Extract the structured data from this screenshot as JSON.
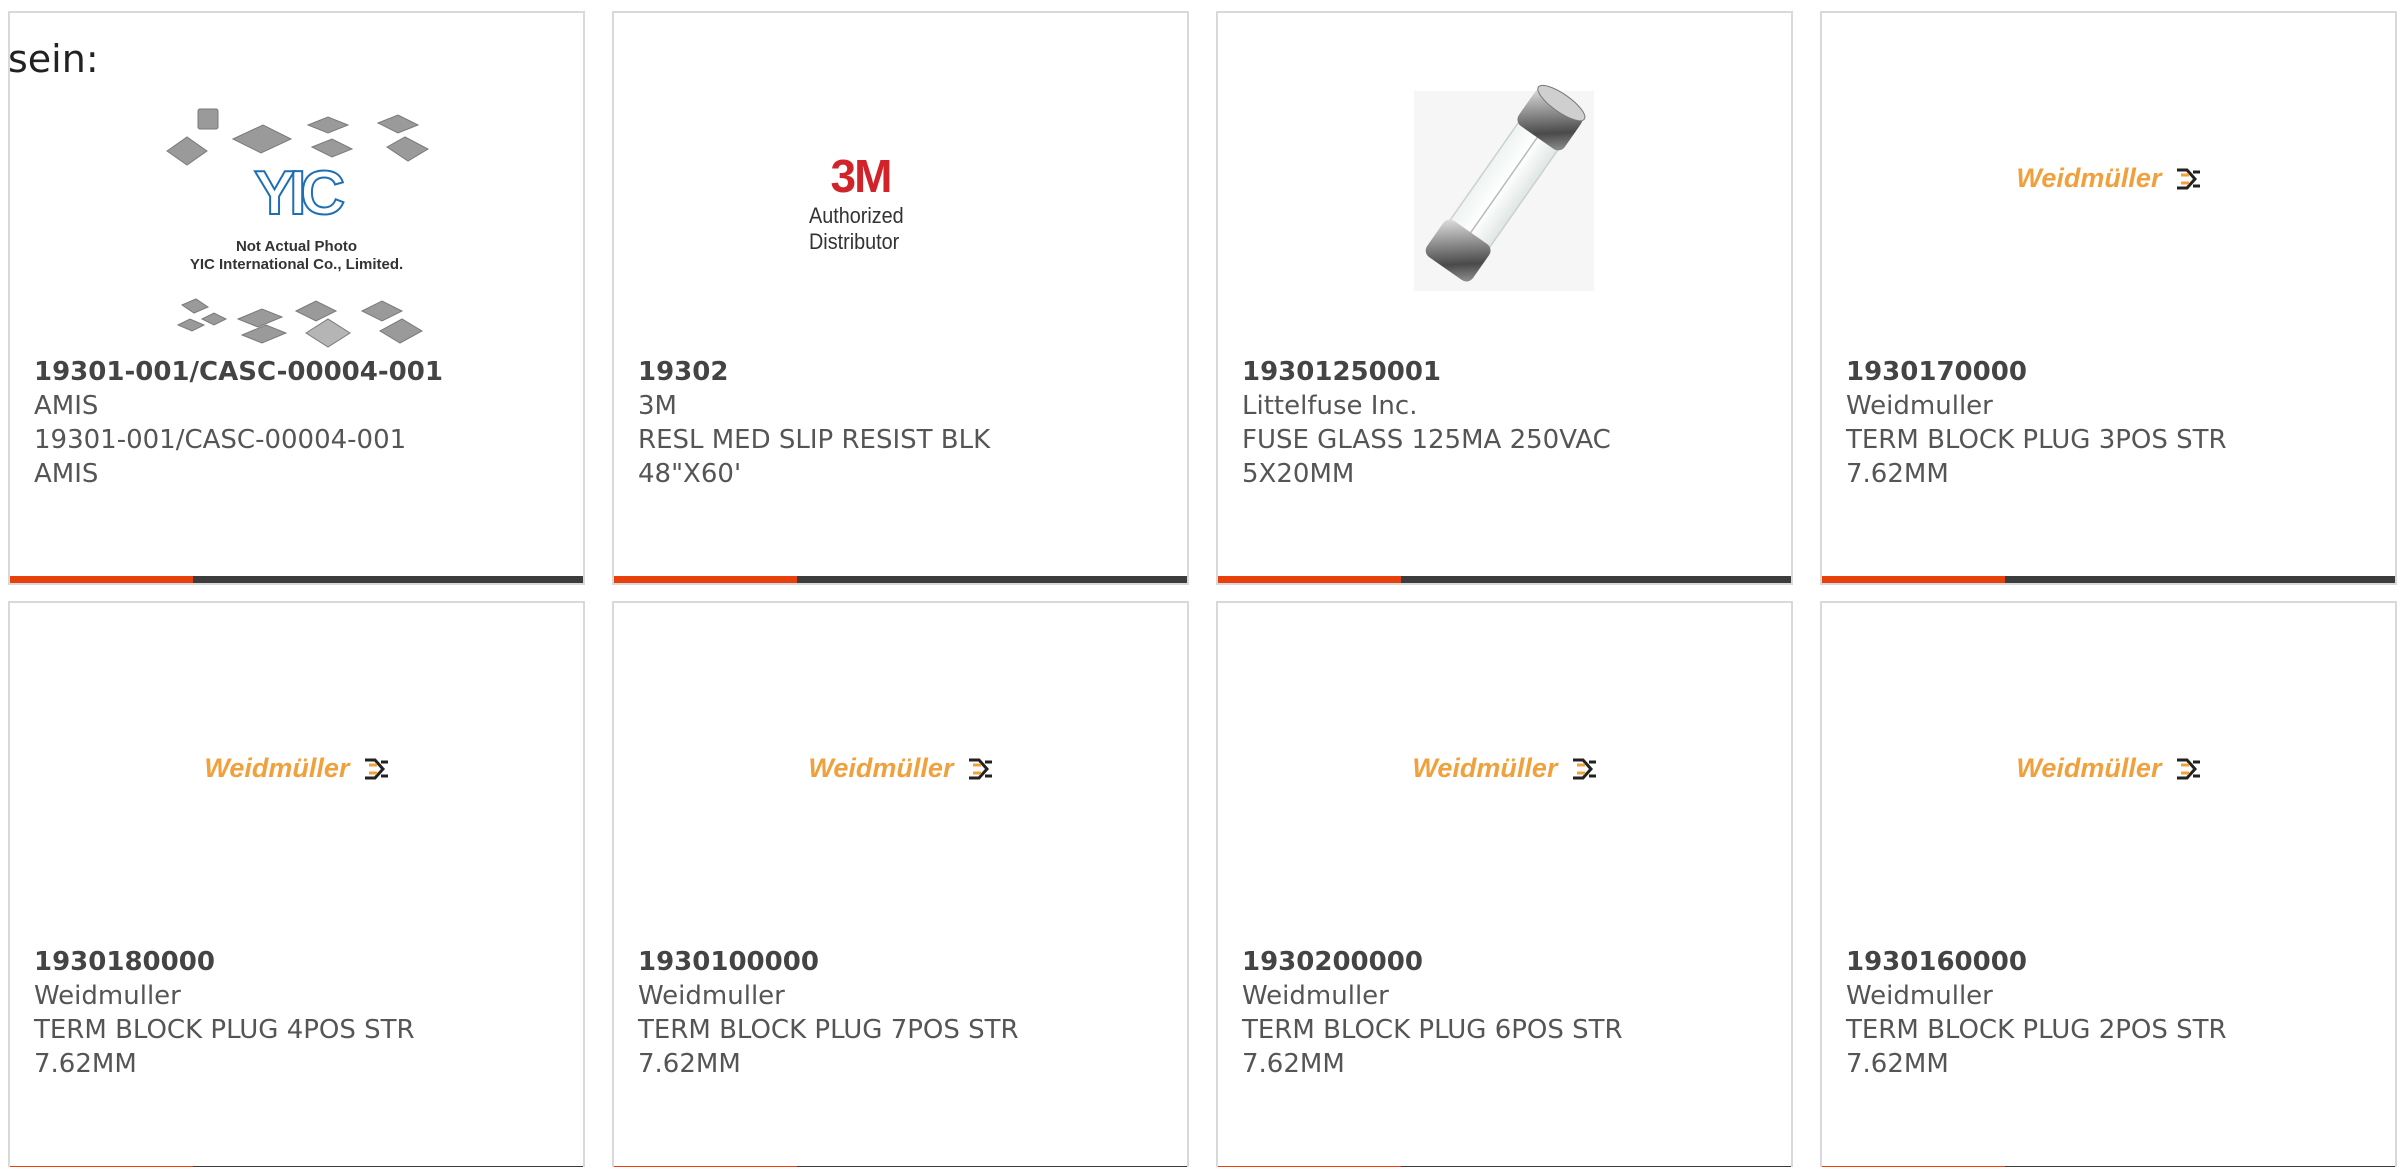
{
  "intro_text": "sein:",
  "colors": {
    "accent": "#e8400c",
    "bar": "#3c3c3c",
    "border": "#d9d9d9",
    "weidmuller": "#f0a03c",
    "logo_3m": "#d2232a",
    "yic_blue": "#1f6fb5"
  },
  "products": [
    {
      "part_number": "19301-001/CASC-00004-001",
      "manufacturer": "AMIS",
      "desc_line1": "19301-001/CASC-00004-001",
      "desc_line2": "AMIS",
      "image": "yic-placeholder",
      "image_caption_1": "Not Actual Photo",
      "image_caption_2": "YIC International Co., Limited.",
      "image_logo": "YIC"
    },
    {
      "part_number": "19302",
      "manufacturer": "3M",
      "desc_line1": "RESL MED SLIP RESIST BLK",
      "desc_line2": "48\"X60'",
      "image": "3m-logo",
      "logo_mark": "3M",
      "logo_sub": "Authorized Distributor"
    },
    {
      "part_number": "19301250001",
      "manufacturer": "Littelfuse Inc.",
      "desc_line1": "FUSE GLASS 125MA 250VAC",
      "desc_line2": "5X20MM",
      "image": "glass-fuse-photo"
    },
    {
      "part_number": "1930170000",
      "manufacturer": "Weidmuller",
      "desc_line1": "TERM BLOCK PLUG 3POS STR",
      "desc_line2": "7.62MM",
      "image": "weidmuller-logo",
      "logo_word": "Weidmüller"
    },
    {
      "part_number": "1930180000",
      "manufacturer": "Weidmuller",
      "desc_line1": "TERM BLOCK PLUG 4POS STR",
      "desc_line2": "7.62MM",
      "image": "weidmuller-logo",
      "logo_word": "Weidmüller"
    },
    {
      "part_number": "1930100000",
      "manufacturer": "Weidmuller",
      "desc_line1": "TERM BLOCK PLUG 7POS STR",
      "desc_line2": "7.62MM",
      "image": "weidmuller-logo",
      "logo_word": "Weidmüller"
    },
    {
      "part_number": "1930200000",
      "manufacturer": "Weidmuller",
      "desc_line1": "TERM BLOCK PLUG 6POS STR",
      "desc_line2": "7.62MM",
      "image": "weidmuller-logo",
      "logo_word": "Weidmüller"
    },
    {
      "part_number": "1930160000",
      "manufacturer": "Weidmuller",
      "desc_line1": "TERM BLOCK PLUG 2POS STR",
      "desc_line2": "7.62MM",
      "image": "weidmuller-logo",
      "logo_word": "Weidmüller"
    }
  ]
}
